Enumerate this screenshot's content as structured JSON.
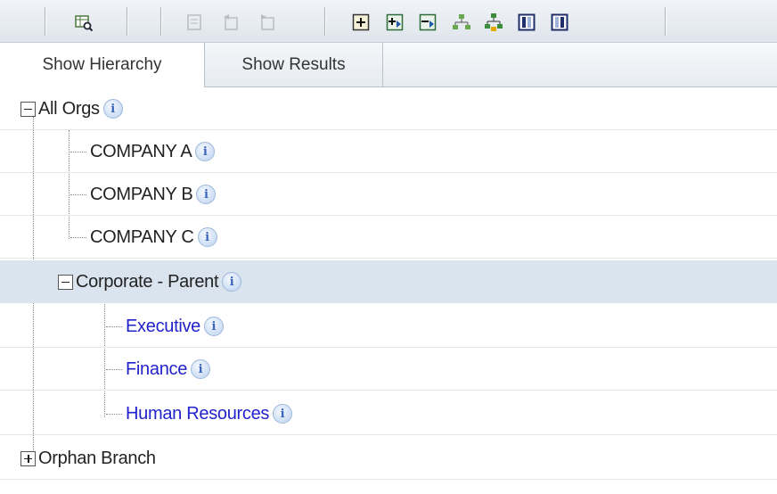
{
  "toolbar": {
    "buttons": [
      {
        "icon": "search-grid-icon",
        "enabled": true
      },
      {
        "icon": "indent-icon",
        "enabled": false
      },
      {
        "icon": "outdent-icon",
        "enabled": false
      },
      {
        "icon": "move-icon",
        "enabled": false
      },
      {
        "icon": "add-node-icon",
        "enabled": true
      },
      {
        "icon": "expand-all-icon",
        "enabled": true
      },
      {
        "icon": "collapse-all-icon",
        "enabled": true
      },
      {
        "icon": "hierarchy-icon",
        "enabled": true
      },
      {
        "icon": "org-chart-icon",
        "enabled": true
      },
      {
        "icon": "column-left-icon",
        "enabled": true
      },
      {
        "icon": "column-right-icon",
        "enabled": true
      }
    ]
  },
  "tabs": [
    {
      "label": "Show Hierarchy",
      "active": true
    },
    {
      "label": "Show Results",
      "active": false
    }
  ],
  "tree": {
    "nodes": [
      {
        "label": "All Orgs",
        "level": 0,
        "toggle": "collapse",
        "link": false
      },
      {
        "label": "COMPANY A",
        "level": 1,
        "toggle": "none",
        "link": false
      },
      {
        "label": "COMPANY B",
        "level": 1,
        "toggle": "none",
        "link": false
      },
      {
        "label": "COMPANY C",
        "level": 1,
        "toggle": "none",
        "link": false
      },
      {
        "label": "Corporate - Parent",
        "level": 1,
        "toggle": "collapse",
        "link": false,
        "selected": true
      },
      {
        "label": "Executive",
        "level": 2,
        "toggle": "none",
        "link": true
      },
      {
        "label": "Finance",
        "level": 2,
        "toggle": "none",
        "link": true
      },
      {
        "label": "Human Resources",
        "level": 2,
        "toggle": "none",
        "link": true
      },
      {
        "label": "Orphan Branch",
        "level": 0,
        "toggle": "expand",
        "link": false
      }
    ],
    "info_glyph": "i"
  }
}
